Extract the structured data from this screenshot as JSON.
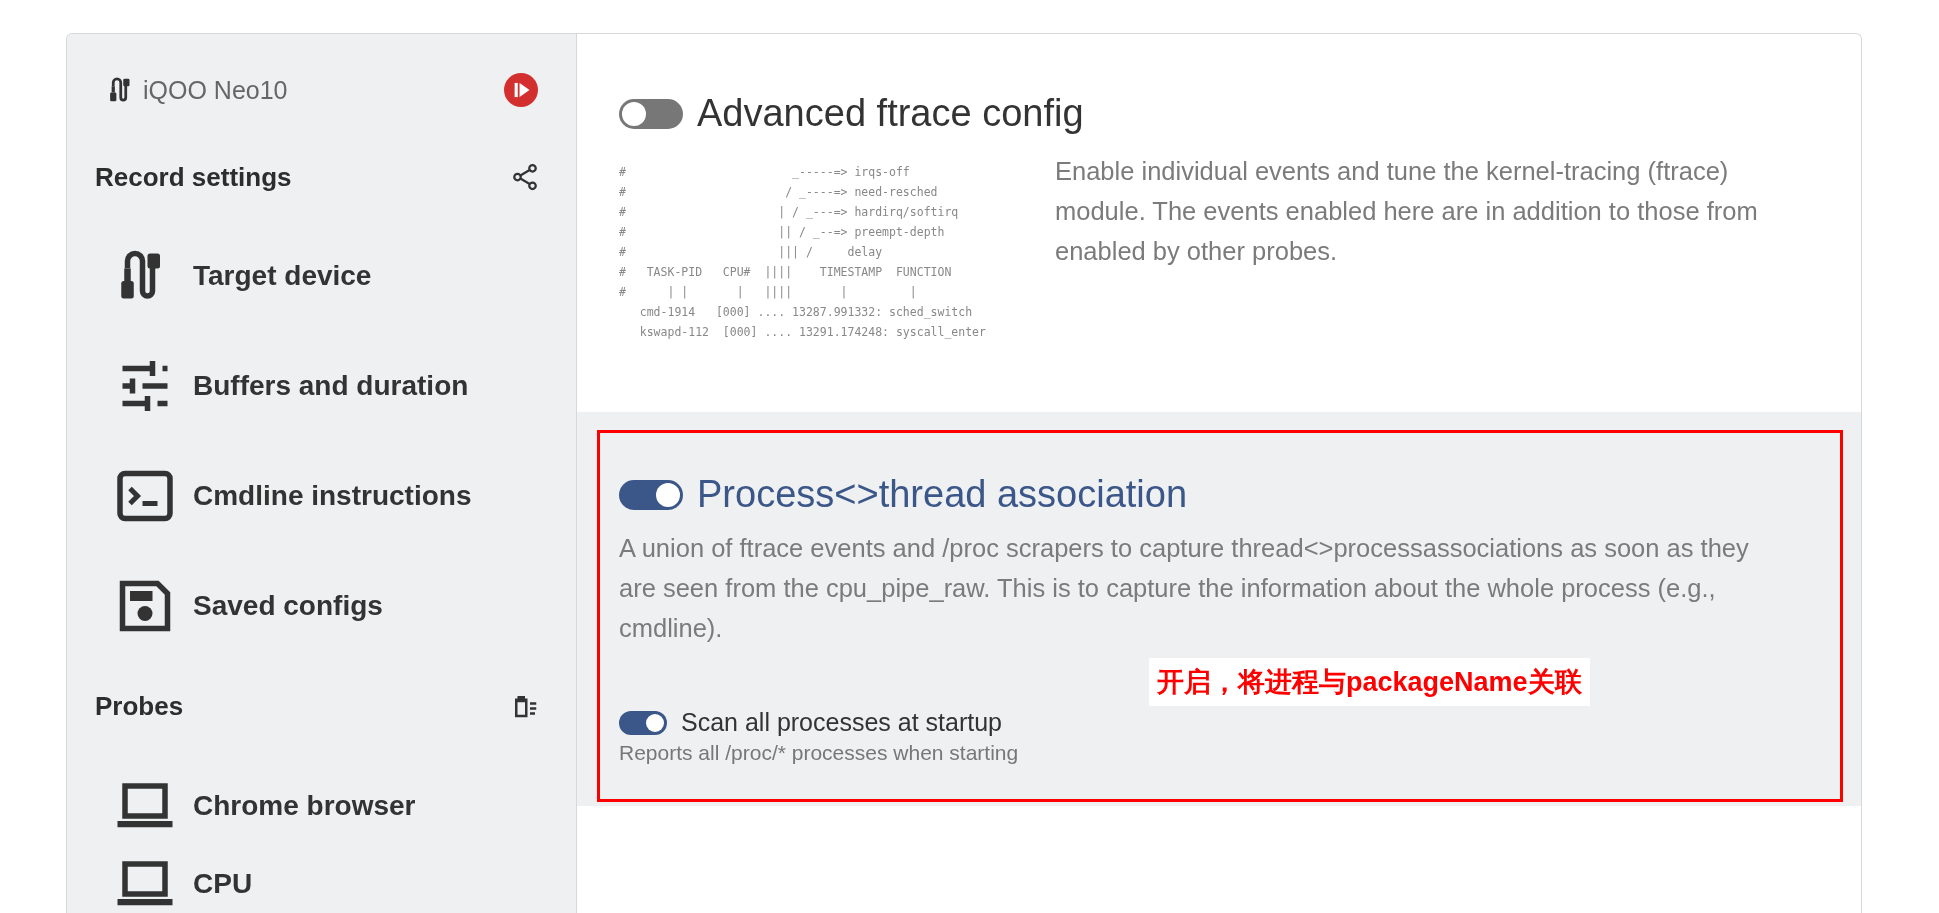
{
  "device": {
    "name": "iQOO Neo10"
  },
  "record_settings": {
    "title": "Record settings",
    "items": [
      {
        "label": "Target device",
        "kind": "cable"
      },
      {
        "label": "Buffers and duration",
        "kind": "tune"
      },
      {
        "label": "Cmdline instructions",
        "kind": "terminal"
      },
      {
        "label": "Saved configs",
        "kind": "save"
      }
    ]
  },
  "probes_menu": {
    "title": "Probes",
    "items": [
      {
        "label": "Chrome browser",
        "kind": "laptop"
      },
      {
        "label": "CPU",
        "kind": "laptop"
      }
    ]
  },
  "probes": [
    {
      "title": "Advanced ftrace config",
      "on": false,
      "description": "Enable individual events and tune the kernel-tracing (ftrace) module. The events enabled here are in addition to those from enabled by other probes.",
      "illustration": [
        "#                        _-----=> irqs-off",
        "#                       / _----=> need-resched",
        "#                      | / _---=> hardirq/softirq",
        "#                      || / _--=> preempt-depth",
        "#                      ||| /     delay",
        "#   TASK-PID   CPU#  ||||    TIMESTAMP  FUNCTION",
        "#      | |       |   ||||       |         |",
        "   cmd-1914   [000] .... 13287.991332: sched_switch",
        "   kswapd-112  [000] .... 13291.174248: syscall_enter"
      ]
    },
    {
      "title": "Process<>thread association",
      "on": true,
      "description": "A union of ftrace events and /proc scrapers to capture thread<>processassociations as soon as they are seen from the cpu_pipe_raw. This is to capture the information about the whole process (e.g., cmdline).",
      "options": [
        {
          "label": "Scan all processes at startup",
          "hint": "Reports all /proc/* processes when starting",
          "on": true
        }
      ]
    }
  ],
  "annotation": {
    "text": "开启，将进程与packageName关联"
  }
}
